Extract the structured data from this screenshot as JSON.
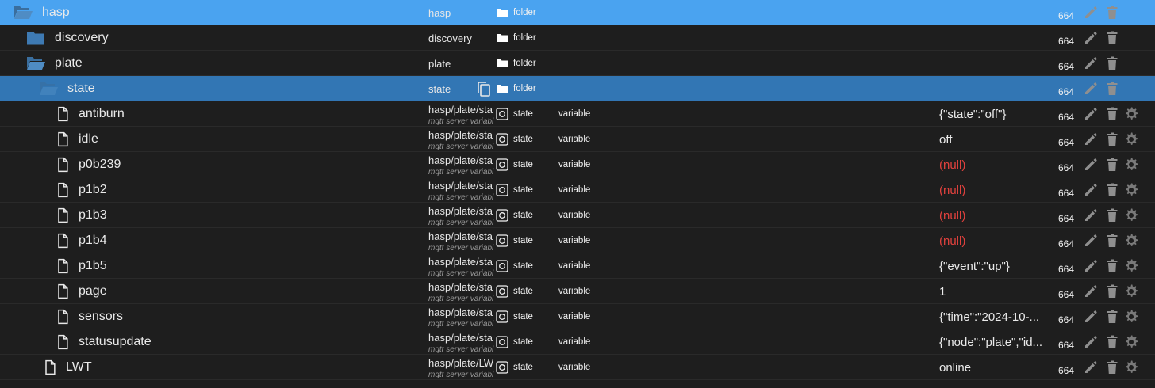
{
  "colors": {
    "accent": "#4aa3f0",
    "selected": "#3276b4",
    "null_value": "#e0413d",
    "background": "#1e1e1e"
  },
  "rows": [
    {
      "name": "hasp",
      "id": "hasp",
      "role": "",
      "type": "folder",
      "value": "",
      "acl": "664"
    },
    {
      "name": "discovery",
      "id": "discovery",
      "role": "",
      "type": "folder",
      "value": "",
      "acl": "664"
    },
    {
      "name": "plate",
      "id": "plate",
      "role": "",
      "type": "folder",
      "value": "",
      "acl": "664"
    },
    {
      "name": "state",
      "id": "state",
      "role": "",
      "type": "folder",
      "value": "",
      "acl": "664"
    },
    {
      "name": "antiburn",
      "id": "hasp/plate/sta",
      "sub": "mqtt server variabl",
      "role": "state",
      "type": "variable",
      "value": "{\"state\":\"off\"}",
      "acl": "664"
    },
    {
      "name": "idle",
      "id": "hasp/plate/sta",
      "sub": "mqtt server variabl",
      "role": "state",
      "type": "variable",
      "value": "off",
      "acl": "664"
    },
    {
      "name": "p0b239",
      "id": "hasp/plate/sta",
      "sub": "mqtt server variabl",
      "role": "state",
      "type": "variable",
      "value": "(null)",
      "acl": "664"
    },
    {
      "name": "p1b2",
      "id": "hasp/plate/sta",
      "sub": "mqtt server variabl",
      "role": "state",
      "type": "variable",
      "value": "(null)",
      "acl": "664"
    },
    {
      "name": "p1b3",
      "id": "hasp/plate/sta",
      "sub": "mqtt server variabl",
      "role": "state",
      "type": "variable",
      "value": "(null)",
      "acl": "664"
    },
    {
      "name": "p1b4",
      "id": "hasp/plate/sta",
      "sub": "mqtt server variabl",
      "role": "state",
      "type": "variable",
      "value": "(null)",
      "acl": "664"
    },
    {
      "name": "p1b5",
      "id": "hasp/plate/sta",
      "sub": "mqtt server variabl",
      "role": "state",
      "type": "variable",
      "value": "{\"event\":\"up\"}",
      "acl": "664"
    },
    {
      "name": "page",
      "id": "hasp/plate/sta",
      "sub": "mqtt server variabl",
      "role": "state",
      "type": "variable",
      "value": "1",
      "acl": "664"
    },
    {
      "name": "sensors",
      "id": "hasp/plate/sta",
      "sub": "mqtt server variabl",
      "role": "state",
      "type": "variable",
      "value": "{\"time\":\"2024-10-...",
      "acl": "664"
    },
    {
      "name": "statusupdate",
      "id": "hasp/plate/sta",
      "sub": "mqtt server variabl",
      "role": "state",
      "type": "variable",
      "value": "{\"node\":\"plate\",\"id...",
      "acl": "664"
    },
    {
      "name": "LWT",
      "id": "hasp/plate/LW",
      "sub": "mqtt server variabl",
      "role": "state",
      "type": "variable",
      "value": "online",
      "acl": "664"
    }
  ]
}
